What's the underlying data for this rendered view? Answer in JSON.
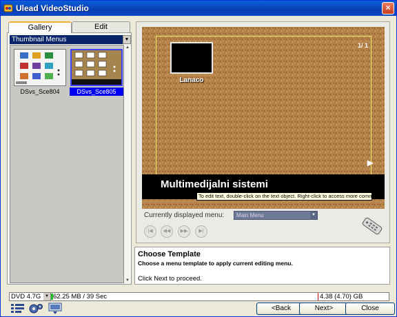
{
  "window": {
    "title": "Ulead VideoStudio",
    "close_glyph": "×"
  },
  "tabs": [
    {
      "label": "Gallery"
    },
    {
      "label": "Edit"
    }
  ],
  "gallery": {
    "category": "Thumbnail Menus",
    "templates": [
      {
        "label": "DSvs_Sce804",
        "selected": false
      },
      {
        "label": "DSvs_Sce805",
        "selected": true
      }
    ]
  },
  "preview": {
    "page_indicator": "1/ 1",
    "thumbnail_label": "Lanaco",
    "menu_title": "Multimedijalni sistemi",
    "tooltip": "To edit text, double-click on the text object. Right-click to access more commands."
  },
  "menu_selector": {
    "label": "Currently displayed menu:",
    "value": "Main Menu"
  },
  "nav_buttons": [
    {
      "name": "first-button",
      "glyph": "|◀"
    },
    {
      "name": "previous-button",
      "glyph": "◀◀"
    },
    {
      "name": "next-button-nav",
      "glyph": "▶▶"
    },
    {
      "name": "last-button",
      "glyph": "▶|"
    }
  ],
  "instructions": {
    "title": "Choose Template",
    "body": "Choose a menu template to apply current editing menu.",
    "next_hint": "Click Next to proceed."
  },
  "statusbar": {
    "disc_type": "DVD 4.7G",
    "used": "62.25 MB / 39 Sec",
    "capacity": "4.38 (4.70) GB",
    "used_fraction": 0.013
  },
  "buttons": {
    "back": "<Back",
    "next": "Next>",
    "close": "Close"
  },
  "icons": [
    "app-icon",
    "chapter-list-icon",
    "settings-gear-icon",
    "preview-output-icon",
    "remote-control-icon",
    "play-arrow-icon"
  ],
  "colors": {
    "selection_blue": "#0000f0",
    "title_bar": "#0a3fb4",
    "cork": "#b07c45",
    "usage_green": "#20c020"
  }
}
